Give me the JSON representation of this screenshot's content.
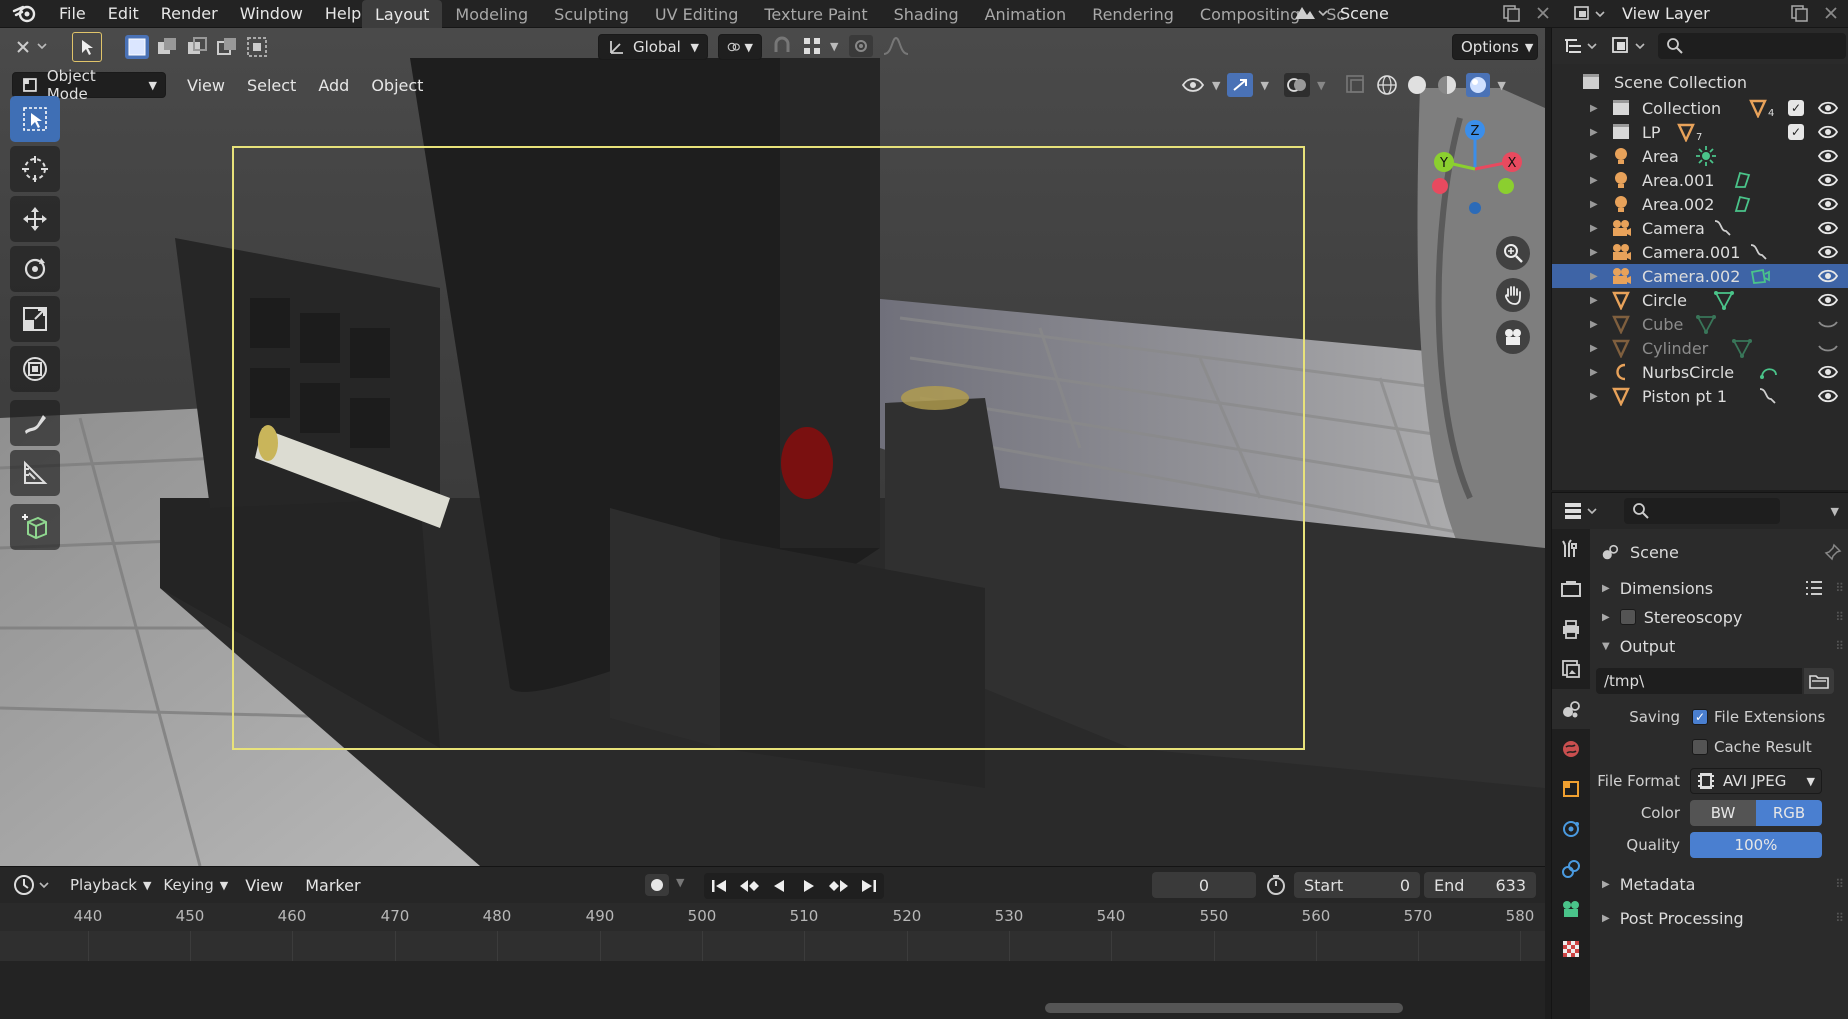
{
  "top_menu": {
    "items": [
      "File",
      "Edit",
      "Render",
      "Window",
      "Help"
    ],
    "workspace_tabs": [
      "Layout",
      "Modeling",
      "Sculpting",
      "UV Editing",
      "Texture Paint",
      "Shading",
      "Animation",
      "Rendering",
      "Compositing",
      "Sc"
    ],
    "active_tab": "Layout",
    "scene": "Scene",
    "view_layer": "View Layer"
  },
  "viewport": {
    "transform_orientation": "Global",
    "options_label": "Options",
    "mode": "Object Mode",
    "menu": [
      "View",
      "Select",
      "Add",
      "Object"
    ],
    "gizmo_axes": [
      "X",
      "Y",
      "Z"
    ],
    "colors": {
      "gizmo_x": "#e84a5f",
      "gizmo_y": "#8bcf2f",
      "gizmo_z": "#3b8eea",
      "camera_frame": "#e8e27a",
      "active_tool": "#3f6fb5"
    }
  },
  "timeline": {
    "menu": [
      "Playback",
      "Keying",
      "View",
      "Marker"
    ],
    "current_frame": "0",
    "start_label": "Start",
    "start": "0",
    "end_label": "End",
    "end": "633",
    "ruler_ticks": [
      "440",
      "450",
      "460",
      "470",
      "480",
      "490",
      "500",
      "510",
      "520",
      "530",
      "540",
      "550",
      "560",
      "570",
      "580"
    ]
  },
  "outliner": {
    "root": "Scene Collection",
    "items": [
      {
        "name": "Collection",
        "icon": "collection-icon",
        "extra": "mesh-data-icon",
        "extra_sub": "4",
        "checkbox": true,
        "visible": true,
        "selected": false,
        "dim": false
      },
      {
        "name": "LP",
        "icon": "collection-icon",
        "extra": "mesh-data-icon",
        "extra_sub": "7",
        "checkbox": true,
        "visible": true,
        "selected": false,
        "dim": false
      },
      {
        "name": "Area",
        "icon": "light-icon",
        "extra": "sun-light-icon",
        "visible": true,
        "selected": false,
        "dim": false
      },
      {
        "name": "Area.001",
        "icon": "light-icon",
        "extra": "light-data-icon",
        "visible": true,
        "selected": false,
        "dim": false
      },
      {
        "name": "Area.002",
        "icon": "light-icon",
        "extra": "light-data-icon",
        "visible": true,
        "selected": false,
        "dim": false
      },
      {
        "name": "Camera",
        "icon": "camera-icon",
        "extra": "constraint-icon",
        "visible": true,
        "selected": false,
        "dim": false
      },
      {
        "name": "Camera.001",
        "icon": "camera-icon",
        "extra": "constraint-icon",
        "visible": true,
        "selected": false,
        "dim": false
      },
      {
        "name": "Camera.002",
        "icon": "camera-icon",
        "extra": "camera-data-icon",
        "visible": true,
        "selected": true,
        "dim": false
      },
      {
        "name": "Circle",
        "icon": "mesh-icon",
        "extra": "vertex-data-icon",
        "visible": true,
        "selected": false,
        "dim": false
      },
      {
        "name": "Cube",
        "icon": "mesh-icon",
        "extra": "vertex-data-icon",
        "visible": false,
        "selected": false,
        "dim": true
      },
      {
        "name": "Cylinder",
        "icon": "mesh-icon",
        "extra": "vertex-data-icon",
        "visible": false,
        "selected": false,
        "dim": true
      },
      {
        "name": "NurbsCircle",
        "icon": "curve-icon",
        "extra": "curve-data-icon",
        "visible": true,
        "selected": false,
        "dim": false
      },
      {
        "name": "Piston pt 1",
        "icon": "mesh-icon",
        "extra": "constraint-icon",
        "visible": true,
        "selected": false,
        "dim": false
      }
    ]
  },
  "properties": {
    "context": "Scene",
    "panels": {
      "dimensions": "Dimensions",
      "stereoscopy": "Stereoscopy",
      "output": "Output",
      "metadata": "Metadata",
      "post_processing": "Post Processing"
    },
    "output_path": "/tmp\\",
    "saving_label": "Saving",
    "file_extensions_label": "File Extensions",
    "file_extensions": true,
    "cache_result_label": "Cache Result",
    "cache_result": false,
    "file_format_label": "File Format",
    "file_format": "AVI JPEG",
    "color_label": "Color",
    "color_options": [
      "BW",
      "RGB"
    ],
    "color_selected": "RGB",
    "quality_label": "Quality",
    "quality": "100%"
  }
}
